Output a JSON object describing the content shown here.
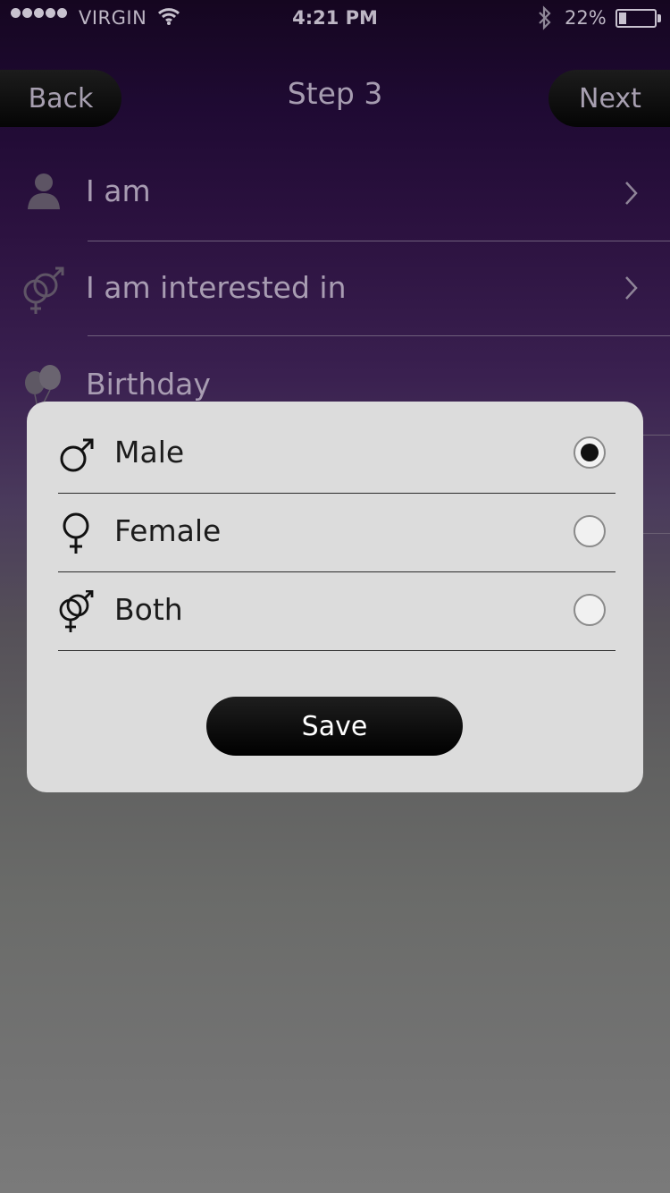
{
  "status_bar": {
    "carrier": "VIRGIN",
    "time": "4:21 PM",
    "battery_percent": "22%",
    "battery_level": 0.22,
    "signal_dots": 5,
    "icons": [
      "signal-dots-icon",
      "wifi-icon",
      "bluetooth-icon",
      "battery-icon"
    ]
  },
  "nav": {
    "back_label": "Back",
    "title": "Step 3",
    "next_label": "Next"
  },
  "settings": {
    "items": [
      {
        "label": "I am",
        "icon": "person-icon",
        "has_chevron": true
      },
      {
        "label": "I am interested in",
        "icon": "gender-both-icon",
        "has_chevron": true
      },
      {
        "label": "Birthday",
        "icon": "balloons-icon",
        "has_chevron": false
      }
    ]
  },
  "modal": {
    "options": [
      {
        "label": "Male",
        "icon": "male-symbol-icon",
        "selected": true
      },
      {
        "label": "Female",
        "icon": "female-symbol-icon",
        "selected": false
      },
      {
        "label": "Both",
        "icon": "male-female-symbol-icon",
        "selected": false
      }
    ],
    "save_label": "Save"
  },
  "colors": {
    "modal_background": "#dcdcdc",
    "button_black": "#000000",
    "purple_top": "#150620",
    "grey_bottom": "#7a7a7a"
  }
}
